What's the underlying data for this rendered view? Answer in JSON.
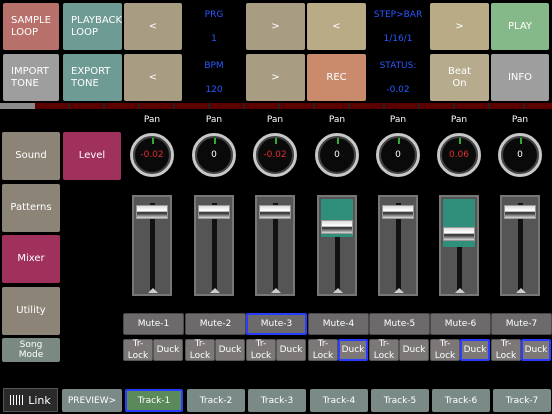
{
  "top": {
    "sample_loop": "SAMPLE\nLOOP",
    "playback_loop": "PLAYBACK\nLOOP",
    "lt1": "<",
    "prg_label": "PRG",
    "prg_value": "1",
    "gt1": ">",
    "lt2": "<",
    "step_bar_label": "STEP>BAR",
    "step_bar_value": "1/16/1",
    "gt2": ">",
    "play": "PLAY",
    "import_tone": "IMPORT\nTONE",
    "export_tone": "EXPORT\nTONE",
    "lt3": "<",
    "bpm_label": "BPM",
    "bpm_value": "120",
    "gt3": ">",
    "rec": "REC",
    "status_label": "STATUS:",
    "status_value": "-0.02",
    "beat_on": "Beat\nOn",
    "info": "INFO"
  },
  "side": {
    "sound": "Sound",
    "level": "Level",
    "patterns": "Patterns",
    "mixer": "Mixer",
    "utility": "Utility",
    "song_mode": "Song\nMode"
  },
  "pan_label": "Pan",
  "knobs": [
    {
      "value": "-0.02",
      "color": "#e03030"
    },
    {
      "value": "0",
      "color": "#ffffff"
    },
    {
      "value": "-0.02",
      "color": "#e03030"
    },
    {
      "value": "0",
      "color": "#ffffff"
    },
    {
      "value": "0",
      "color": "#ffffff"
    },
    {
      "value": "0.06",
      "color": "#e03030"
    },
    {
      "value": "0",
      "color": "#ffffff"
    }
  ],
  "faders": [
    {
      "level": 0.92,
      "teal": false
    },
    {
      "level": 0.92,
      "teal": false
    },
    {
      "level": 0.92,
      "teal": false
    },
    {
      "level": 0.7,
      "teal": true
    },
    {
      "level": 0.92,
      "teal": false
    },
    {
      "level": 0.6,
      "teal": true
    },
    {
      "level": 0.92,
      "teal": false
    }
  ],
  "mutes": [
    "Mute-1",
    "Mute-2",
    "Mute-3",
    "Mute-4",
    "Mute-5",
    "Mute-6",
    "Mute-7"
  ],
  "trlock": "Tr-Lock",
  "duck": "Duck",
  "link": "Link",
  "preview": "PREVIEW>",
  "tracks": [
    "Track-1",
    "Track-2",
    "Track-3",
    "Track-4",
    "Track-5",
    "Track-6",
    "Track-7"
  ]
}
